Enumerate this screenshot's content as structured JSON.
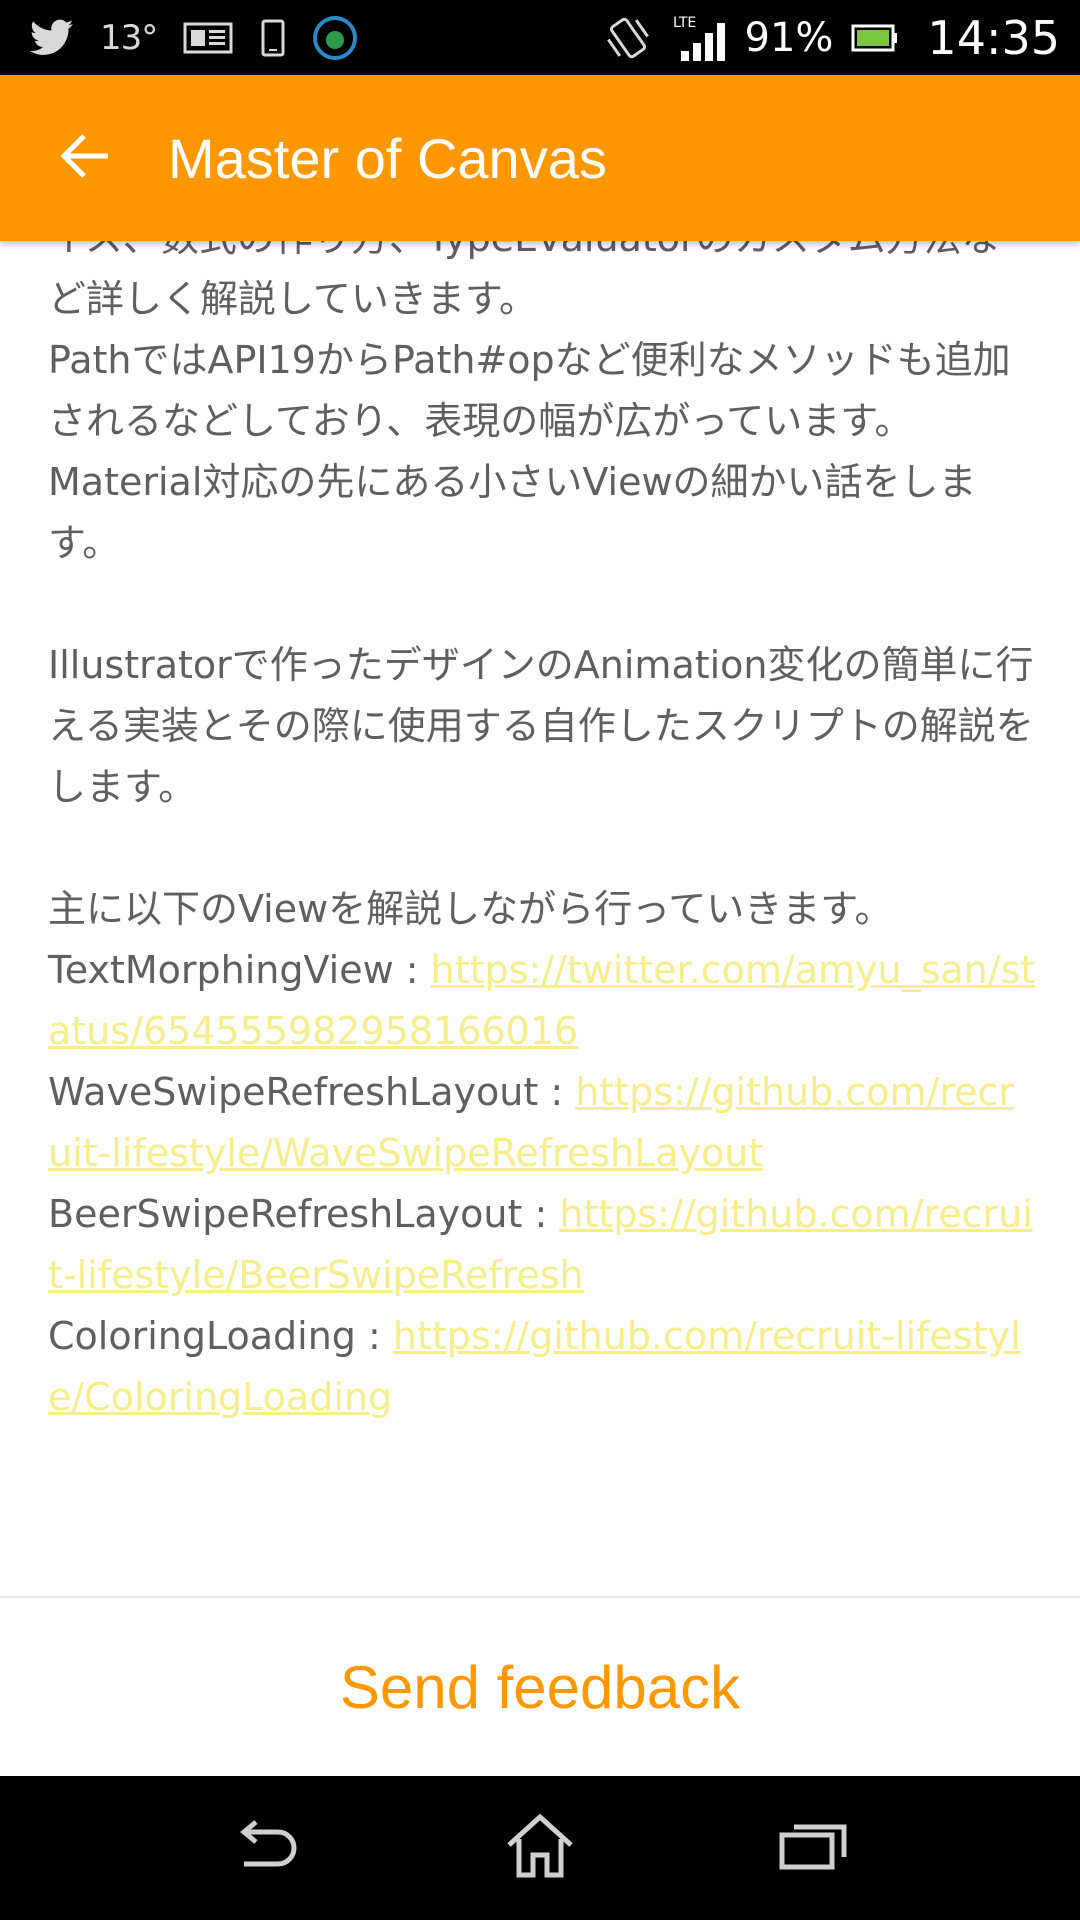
{
  "status_bar": {
    "temperature": "13°",
    "network": "LTE",
    "battery": "91%",
    "time": "14:35",
    "icons": [
      "twitter-icon",
      "news-icon",
      "phone-icon",
      "app-circle-icon",
      "vibrate-icon",
      "signal-icon",
      "battery-icon"
    ]
  },
  "app_bar": {
    "title": "Master of Canvas",
    "back_icon": "arrow-back-icon"
  },
  "content": {
    "para1_partial": "イス、数式の作り方、TypeEvaluatorのカスタム方法などど詳しく解説していきます。",
    "para1_line": "ど詳しく解説していきます。",
    "para2": "PathではAPI19からPath#opなど便利なメソッドも追加されるなどしており、表現の幅が広がっています。",
    "para3": "Material対応の先にある小さいViewの細かい話をします。",
    "para4": "Illustratorで作ったデザインのAnimation変化の簡単に行える実装とその際に使用する自作したスクリプトの解説をします。",
    "para5": "主に以下のViewを解説しながら行っていきます。",
    "links": [
      {
        "label": "TextMorphingView : ",
        "url": "https://twitter.com/amyu_san/status/654555982958166016"
      },
      {
        "label": "WaveSwipeRefreshLayout : ",
        "url": "https://github.com/recruit-lifestyle/WaveSwipeRefreshLayout"
      },
      {
        "label": "BeerSwipeRefreshLayout : ",
        "url": "https://github.com/recruit-lifestyle/BeerSwipeRefresh"
      },
      {
        "label": "ColoringLoading : ",
        "url": "https://github.com/recruit-lifestyle/ColoringLoading"
      }
    ]
  },
  "footer": {
    "feedback_label": "Send feedback"
  },
  "nav_bar": {
    "icons": [
      "back-nav-icon",
      "home-icon",
      "recents-icon"
    ]
  },
  "colors": {
    "accent": "#ff9800",
    "link": "#f5ee8a",
    "text": "#5f5f5f"
  }
}
